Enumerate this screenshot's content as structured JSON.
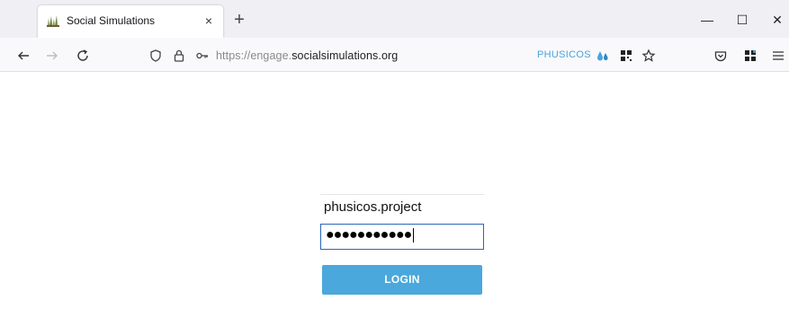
{
  "browser": {
    "tab": {
      "title": "Social Simulations",
      "close_label": "×",
      "favicon": "grass-leaf-icon"
    },
    "new_tab_label": "+",
    "window_controls": {
      "minimize": "—",
      "maximize": "☐",
      "close": "✕"
    },
    "address_bar": {
      "url_prefix": "https://engage.",
      "url_host": "socialsimulations.org",
      "icons": [
        "shield-icon",
        "lock-icon",
        "key-icon"
      ]
    },
    "extension_badge": "PHUSICOS",
    "toolbar_icons": [
      "back-icon",
      "forward-icon",
      "reload-icon",
      "qr-grid-icon",
      "star-icon",
      "pocket-icon",
      "extensions-icon",
      "menu-icon"
    ]
  },
  "login": {
    "username_value": "phusicos.project",
    "password_mask": "●●●●●●●●●●●",
    "button_label": "LOGIN",
    "accent_color": "#4aa8dd",
    "focus_border_color": "#2a66b7"
  }
}
